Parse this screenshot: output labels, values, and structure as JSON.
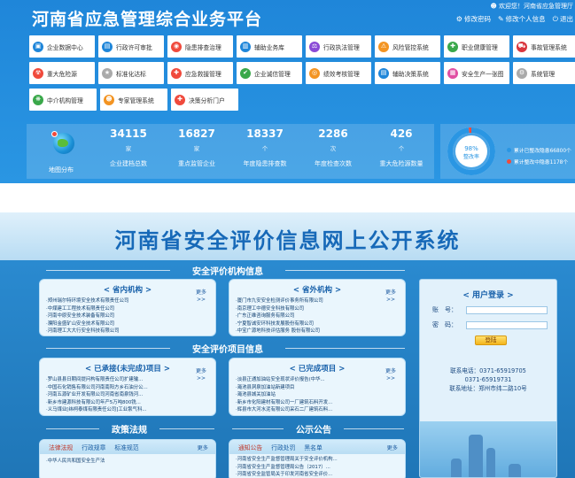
{
  "top": {
    "title": "河南省应急管理综合业务平台",
    "welcome": "欢迎您！河南省应急管理厅",
    "links": {
      "change_password": "修改密码",
      "edit_profile": "修改个人信息",
      "logout": "退出"
    },
    "modules": [
      [
        {
          "label": "企业数据中心",
          "color": "#1f86d9",
          "glyph": "▣"
        },
        {
          "label": "行政许可审批",
          "color": "#1f86d9",
          "glyph": "▤"
        },
        {
          "label": "隐患排查治理",
          "color": "#f04a3c",
          "glyph": "◉"
        },
        {
          "label": "辅助业务库",
          "color": "#1f86d9",
          "glyph": "▥"
        },
        {
          "label": "行政执法管理",
          "color": "#8a4ad6",
          "glyph": "⚖"
        },
        {
          "label": "风险管控系统",
          "color": "#f39422",
          "glyph": "⚠"
        },
        {
          "label": "职业健康管理",
          "color": "#3aa84a",
          "glyph": "✚"
        },
        {
          "label": "事故管理系统",
          "color": "#d9363e",
          "glyph": "⛟"
        }
      ],
      [
        {
          "label": "重大危险源",
          "color": "#f04a3c",
          "glyph": "☢"
        },
        {
          "label": "标准化达标",
          "color": "#aaaaaa",
          "glyph": "★"
        },
        {
          "label": "应急救援管理",
          "color": "#f04a3c",
          "glyph": "✚"
        },
        {
          "label": "企业诚信管理",
          "color": "#3aa84a",
          "glyph": "✔"
        },
        {
          "label": "绩效考核管理",
          "color": "#f39422",
          "glyph": "◎"
        },
        {
          "label": "辅助决策系统",
          "color": "#1f86d9",
          "glyph": "▤"
        },
        {
          "label": "安全生产一张图",
          "color": "#e14fa3",
          "glyph": "▦"
        },
        {
          "label": "系统管理",
          "color": "#aaaaaa",
          "glyph": "⚙"
        }
      ],
      [
        {
          "label": "中介机构管理",
          "color": "#3aa84a",
          "glyph": "❋"
        },
        {
          "label": "专家管理系统",
          "color": "#f39422",
          "glyph": "☻"
        },
        {
          "label": "决策分析门户",
          "color": "#f04a3c",
          "glyph": "✚"
        }
      ]
    ],
    "map_label": "地图分布",
    "stats": [
      {
        "num": "34115",
        "unit": "家",
        "label": "企业建档总数"
      },
      {
        "num": "16827",
        "unit": "家",
        "label": "重点监管企业"
      },
      {
        "num": "18337",
        "unit": "个",
        "label": "年度隐患排查数"
      },
      {
        "num": "2286",
        "unit": "次",
        "label": "年度检查次数"
      },
      {
        "num": "426",
        "unit": "个",
        "label": "重大危险源数量"
      }
    ],
    "ring": {
      "percent": "98%",
      "caption": "整改率",
      "value": 0.98,
      "legend": [
        {
          "text": "累计已整改隐患66800个",
          "color": "#2a96e3"
        },
        {
          "text": "累计整改中隐患1178个",
          "color": "#f04a3c"
        }
      ]
    }
  },
  "bottom": {
    "title": "河南省安全评价信息网上公开系统",
    "sections": {
      "institutions": "安全评价机构信息",
      "projects": "安全评价项目信息",
      "regulations": "政策法规",
      "notices": "公示公告"
    },
    "more": "更多",
    "more_arrow": ">>",
    "province_orgs": {
      "title": "< 省内机构 >",
      "items": [
        "·郑州瑞尔特环境安全技术有限责任公司",
        "·中煤建工工程技术有限责任公司",
        "·河南中原安全技术装备有限公司",
        "·濮阳金盛矿山安全技术有限公司",
        "·河南理工大大行安全科技有限公司"
      ]
    },
    "outside_orgs": {
      "title": "< 省外机构 >",
      "items": [
        "·厦门市九安安全检测评价事务所有限公司",
        "·南京理工中德安全科技有限公司",
        "·广东正维咨询服务有限公司",
        "·宁夏智诚安环科技发展股份有限公司",
        "·中宝广源地科技评估服务 股份有限公司"
      ]
    },
    "pending_projects": {
      "title": "< 已承接(未完成)项目 >",
      "items": [
        "·罗山县县日期间提问构有限责任公司扩建输...",
        "·中国石化销售有限公司河南南阳方乡石油分公...",
        "·河南五源矿业开发有限公司河南省南泉钱河...",
        "·新乡市建源科技有限公司年产5万吨800铣...",
        "·义马煤业[纬柯泰煤有限责任公司]工业泵气科..."
      ]
    },
    "done_projects": {
      "title": "< 已完成项目 >",
      "items": [
        "·淡县正通加油站安全现状评价报告(中华...",
        "·渑池县洞泉加油站新建项目",
        "·渑池县城关加油站",
        "·新乡市化阳建材有限公司一厂建筑石料开发...",
        "·辉县市大河水泥有限公司采石二厂建筑石料..."
      ]
    },
    "regulation_tabs": [
      "法律法规",
      "行政规章",
      "标准规范"
    ],
    "regulation_items": [
      "·中华人民共和国安全生产法"
    ],
    "notice_tabs": [
      "通知公告",
      "行政处罚",
      "黑名单"
    ],
    "notice_items": [
      "·河南省安全生产监督管理局关于安全评价机构...",
      "·河南省安全生产监督管理局公告〔2017〕...",
      "·河南省安全监管局关于印发河南省安全评价..."
    ],
    "login": {
      "title": "< 用户登录 >",
      "account_label": "账　号：",
      "password_label": "密　码：",
      "button": "登陆",
      "phone": "联系电话：0371-65919705",
      "phone2": "0371-65919731",
      "address": "联系地址：郑州市纬二路10号"
    }
  }
}
